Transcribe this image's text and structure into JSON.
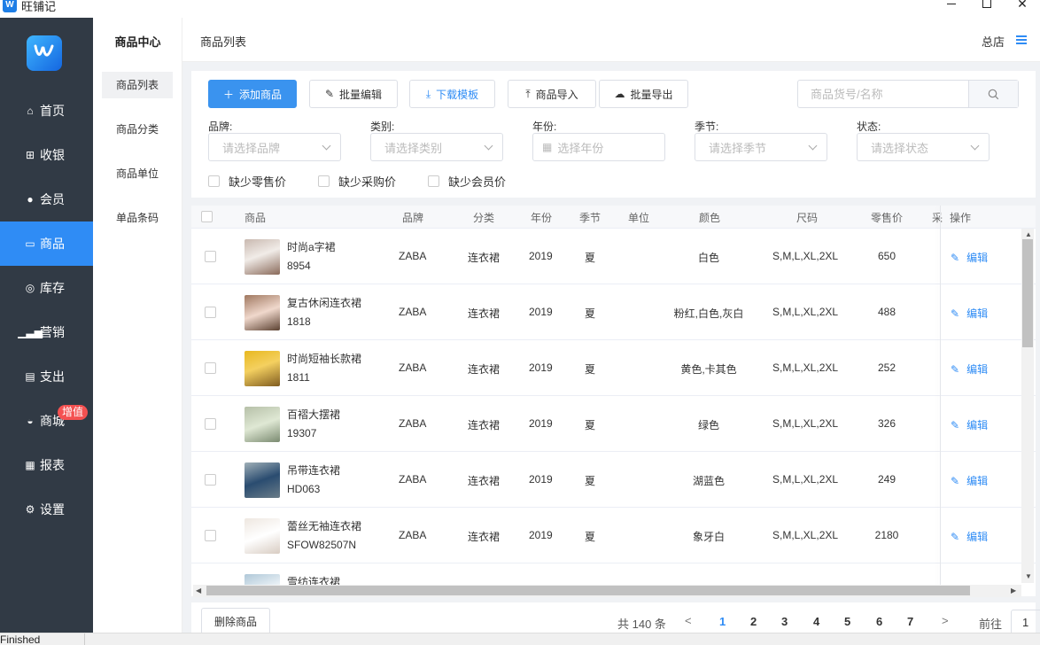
{
  "window": {
    "title": "旺铺记",
    "status": "Finished"
  },
  "sidebar": {
    "items": [
      {
        "label": "首页",
        "icon": "home-icon",
        "active": false
      },
      {
        "label": "收银",
        "icon": "cashier-icon",
        "active": false
      },
      {
        "label": "会员",
        "icon": "members-icon",
        "active": false
      },
      {
        "label": "商品",
        "icon": "products-icon",
        "active": true
      },
      {
        "label": "库存",
        "icon": "inventory-icon",
        "active": false
      },
      {
        "label": "营销",
        "icon": "marketing-icon",
        "active": false
      },
      {
        "label": "支出",
        "icon": "expense-icon",
        "active": false
      },
      {
        "label": "商城",
        "icon": "mall-icon",
        "active": false,
        "badge": "增值"
      },
      {
        "label": "报表",
        "icon": "report-icon",
        "active": false
      },
      {
        "label": "设置",
        "icon": "settings-icon",
        "active": false
      }
    ]
  },
  "subnav": {
    "title": "商品中心",
    "items": [
      {
        "label": "商品列表",
        "active": true
      },
      {
        "label": "商品分类",
        "active": false
      },
      {
        "label": "商品单位",
        "active": false
      },
      {
        "label": "单品条码",
        "active": false
      }
    ]
  },
  "header": {
    "breadcrumb": "商品列表",
    "store": "总店"
  },
  "toolbar": {
    "add": "添加商品",
    "batch_edit": "批量编辑",
    "download_template": "下载模板",
    "import": "商品导入",
    "export": "批量导出",
    "search_placeholder": "商品货号/名称"
  },
  "filters": {
    "brand": {
      "label": "品牌:",
      "placeholder": "请选择品牌"
    },
    "category": {
      "label": "类别:",
      "placeholder": "请选择类别"
    },
    "year": {
      "label": "年份:",
      "placeholder": "选择年份"
    },
    "season": {
      "label": "季节:",
      "placeholder": "请选择季节"
    },
    "status": {
      "label": "状态:",
      "placeholder": "请选择状态"
    },
    "checks": [
      "缺少零售价",
      "缺少采购价",
      "缺少会员价"
    ]
  },
  "table": {
    "headers": {
      "product": "商品",
      "brand": "品牌",
      "category": "分类",
      "year": "年份",
      "season": "季节",
      "unit": "单位",
      "color": "颜色",
      "size": "尺码",
      "retail": "零售价",
      "purchase": "采",
      "action": "操作"
    },
    "edit_label": "编辑",
    "rows": [
      {
        "name": "时尚a字裙",
        "code": "8954",
        "brand": "ZABA",
        "category": "连衣裙",
        "year": "2019",
        "season": "夏",
        "color": "白色",
        "size": "S,M,L,XL,2XL",
        "price": "650"
      },
      {
        "name": "复古休闲连衣裙",
        "code": "1818",
        "brand": "ZABA",
        "category": "连衣裙",
        "year": "2019",
        "season": "夏",
        "color": "粉红,白色,灰白",
        "size": "S,M,L,XL,2XL",
        "price": "488"
      },
      {
        "name": "时尚短袖长款裙",
        "code": "1811",
        "brand": "ZABA",
        "category": "连衣裙",
        "year": "2019",
        "season": "夏",
        "color": "黄色,卡其色",
        "size": "S,M,L,XL,2XL",
        "price": "252"
      },
      {
        "name": "百褶大摆裙",
        "code": "19307",
        "brand": "ZABA",
        "category": "连衣裙",
        "year": "2019",
        "season": "夏",
        "color": "绿色",
        "size": "S,M,L,XL,2XL",
        "price": "326"
      },
      {
        "name": "吊带连衣裙",
        "code": "HD063",
        "brand": "ZABA",
        "category": "连衣裙",
        "year": "2019",
        "season": "夏",
        "color": "湖蓝色",
        "size": "S,M,L,XL,2XL",
        "price": "249"
      },
      {
        "name": "蕾丝无袖连衣裙",
        "code": "SFOW82507N",
        "brand": "ZABA",
        "category": "连衣裙",
        "year": "2019",
        "season": "夏",
        "color": "象牙白",
        "size": "S,M,L,XL,2XL",
        "price": "2180"
      },
      {
        "name": "雪纺连衣裙",
        "code": "",
        "brand": "",
        "category": "",
        "year": "",
        "season": "",
        "color": "",
        "size": "",
        "price": ""
      }
    ]
  },
  "footer": {
    "delete": "删除商品",
    "total": "共 140 条",
    "prev": "<",
    "next": ">",
    "pages": [
      "1",
      "2",
      "3",
      "4",
      "5",
      "6",
      "7"
    ],
    "active_page": "1",
    "goto_label": "前往",
    "goto_value": "1"
  },
  "colors": {
    "accent": "#2f8cf5",
    "sidebar": "#313a45",
    "badge": "#f45151"
  }
}
